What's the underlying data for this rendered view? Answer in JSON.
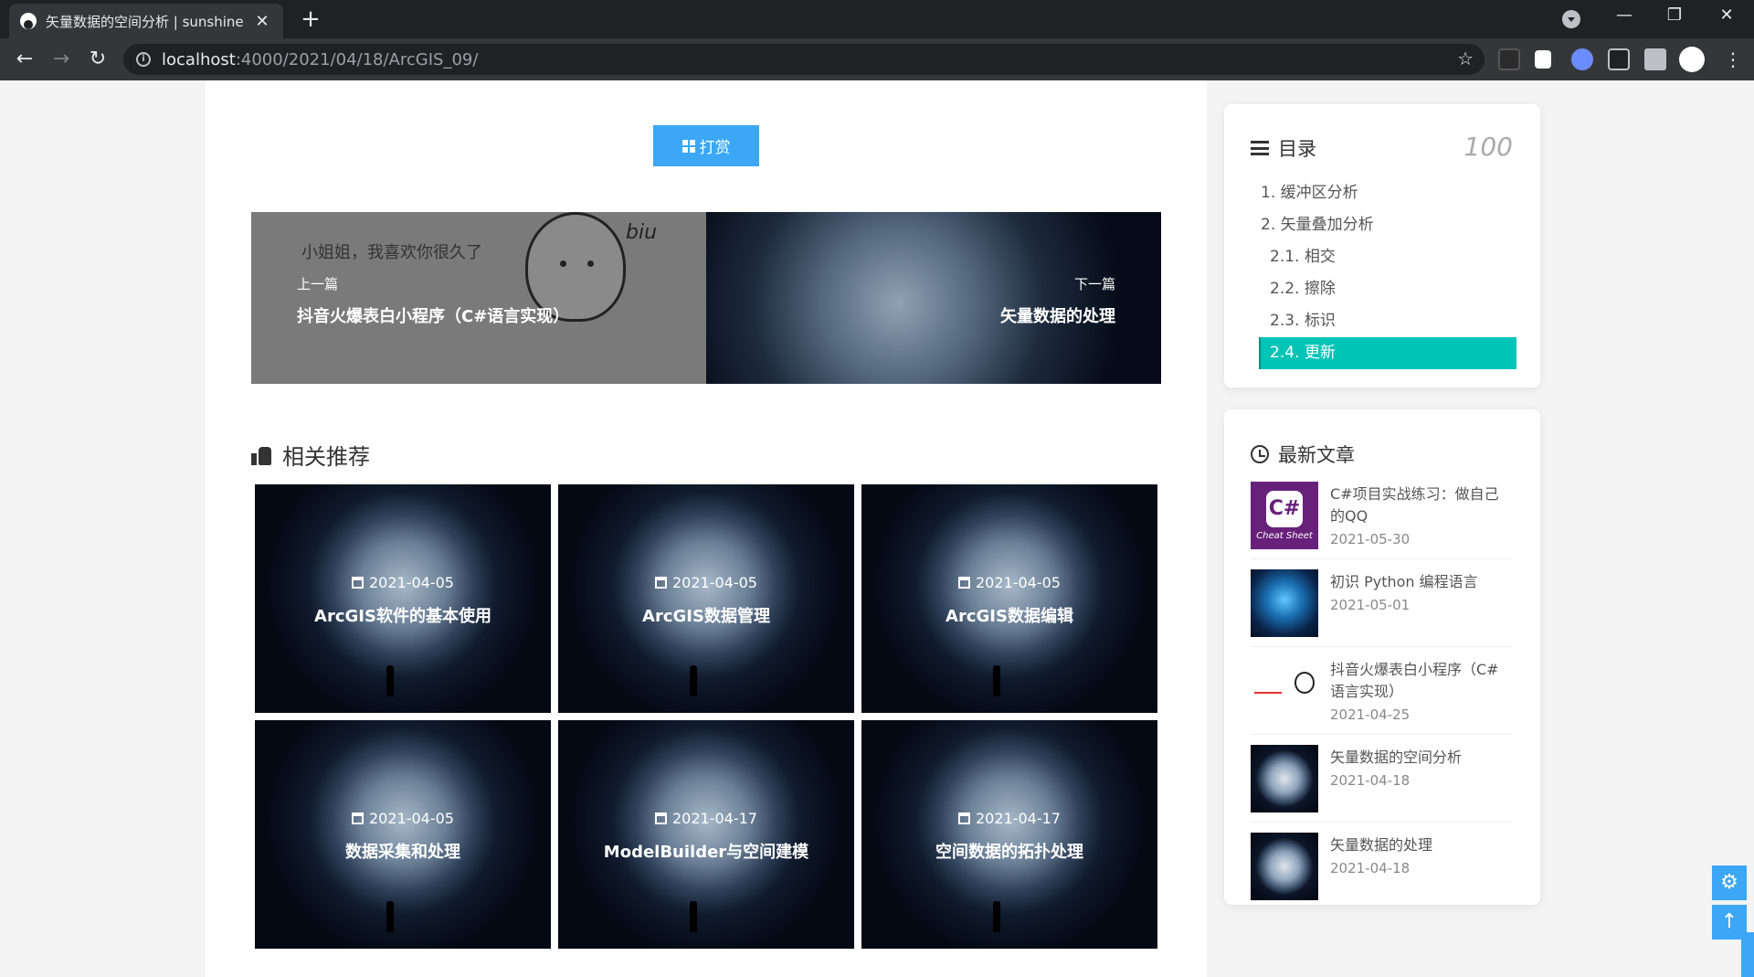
{
  "browser": {
    "tab_title": "矢量数据的空间分析 | sunshine",
    "tab_close": "✕",
    "new_tab": "+",
    "url_host": "localhost",
    "url_path": ":4000/2021/04/18/ArcGIS_09/",
    "back": "←",
    "forward": "→",
    "reload": "↻",
    "star": "☆",
    "minimize": "—",
    "restore": "❐",
    "close": "✕"
  },
  "reward": {
    "label": "打赏"
  },
  "pager": {
    "prev_label": "上一篇",
    "prev_title": "抖音火爆表白小程序（C#语言实现）",
    "prev_image_text": "小姐姐，我喜欢你很久了",
    "prev_image_biu": "biu",
    "next_label": "下一篇",
    "next_title": "矢量数据的处理"
  },
  "related": {
    "heading": "相关推荐",
    "items": [
      {
        "date": "2021-04-05",
        "title": "ArcGIS软件的基本使用"
      },
      {
        "date": "2021-04-05",
        "title": "ArcGIS数据管理"
      },
      {
        "date": "2021-04-05",
        "title": "ArcGIS数据编辑"
      },
      {
        "date": "2021-04-05",
        "title": "数据采集和处理"
      },
      {
        "date": "2021-04-17",
        "title": "ModelBuilder与空间建模"
      },
      {
        "date": "2021-04-17",
        "title": "空间数据的拓扑处理"
      }
    ]
  },
  "toc": {
    "heading": "目录",
    "progress": "100",
    "items": [
      {
        "label": "1. 缓冲区分析"
      },
      {
        "label": "2. 矢量叠加分析"
      },
      {
        "label": "2.1. 相交"
      },
      {
        "label": "2.2. 擦除"
      },
      {
        "label": "2.3. 标识"
      },
      {
        "label": "2.4. 更新"
      }
    ],
    "active_color": "#00c4b6"
  },
  "recent": {
    "heading": "最新文章",
    "items": [
      {
        "title": "C#项目实战练习：做自己的QQ",
        "date": "2021-05-30",
        "thumb_text": "C#",
        "thumb_caption": "Cheat Sheet"
      },
      {
        "title": "初识 Python 编程语言",
        "date": "2021-05-01"
      },
      {
        "title": "抖音火爆表白小程序（C#语言实现）",
        "date": "2021-04-25"
      },
      {
        "title": "矢量数据的空间分析",
        "date": "2021-04-18"
      },
      {
        "title": "矢量数据的处理",
        "date": "2021-04-18"
      }
    ]
  },
  "floating": {
    "settings": "⚙",
    "top": "↑"
  },
  "colors": {
    "accent": "#3ba7f5",
    "toc_active": "#00c4b6"
  }
}
